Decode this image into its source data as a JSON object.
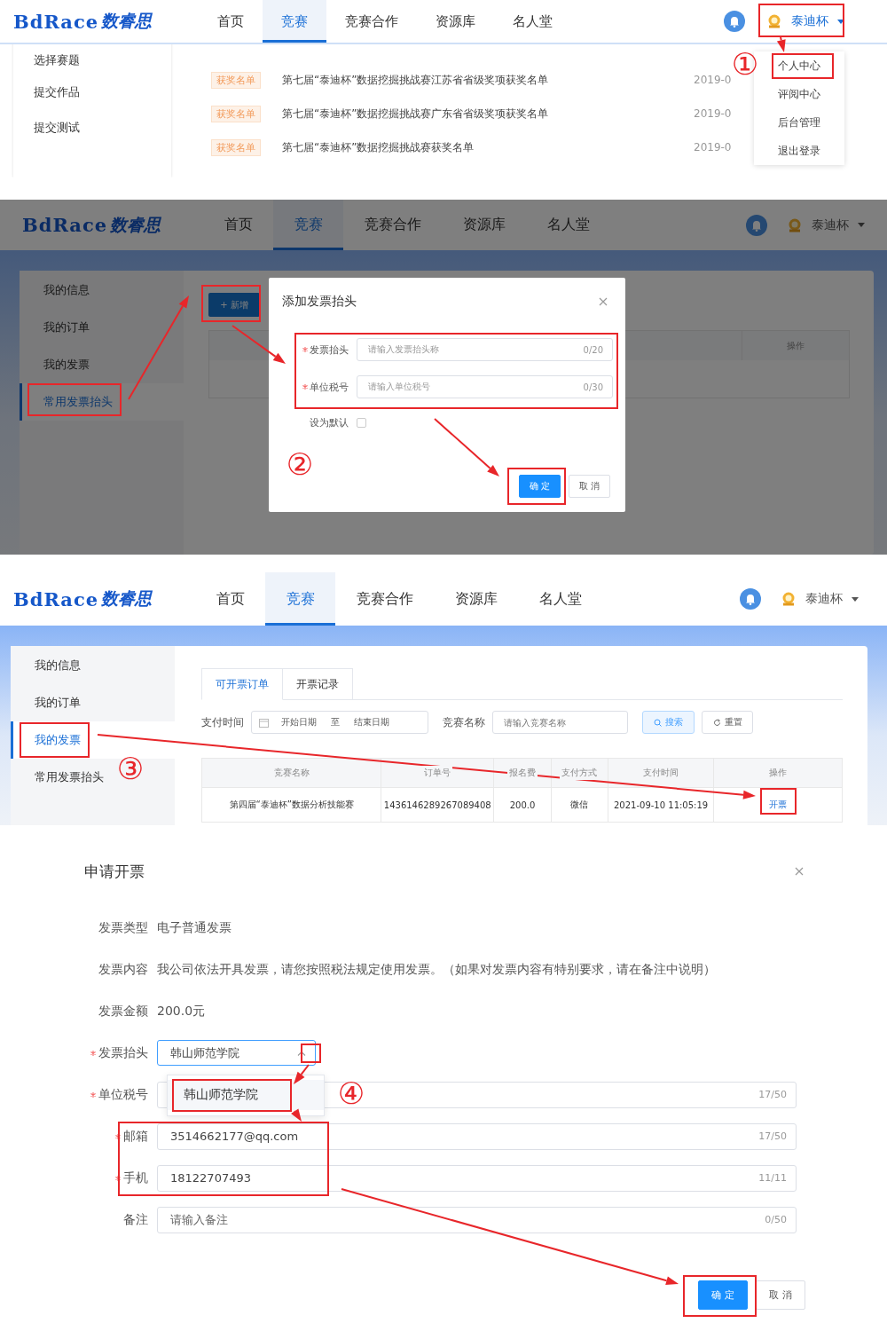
{
  "step1": {
    "header": {
      "logo_latin": "BdRace",
      "logo_cjk": "数睿思",
      "nav": [
        {
          "label": "首页",
          "selected": false
        },
        {
          "label": "竞赛",
          "selected": true
        },
        {
          "label": "竞赛合作",
          "selected": false
        },
        {
          "label": "资源库",
          "selected": false
        },
        {
          "label": "名人堂",
          "selected": false
        }
      ],
      "user": {
        "name": "泰迪杯",
        "active": true
      }
    },
    "sidebar": [
      "选择赛题",
      "提交作品",
      "提交测试"
    ],
    "news": [
      {
        "tag": "获奖名单",
        "title": "第七届“泰迪杯”数据挖掘挑战赛江苏省省级奖项获奖名单",
        "date": "2019-0"
      },
      {
        "tag": "获奖名单",
        "title": "第七届“泰迪杯”数据挖掘挑战赛广东省省级奖项获奖名单",
        "date": "2019-0"
      },
      {
        "tag": "获奖名单",
        "title": "第七届“泰迪杯”数据挖掘挑战赛获奖名单",
        "date": "2019-0"
      }
    ],
    "user_menu": [
      "个人中心",
      "评阅中心",
      "后台管理",
      "退出登录"
    ],
    "marker": "①"
  },
  "step2": {
    "header": {
      "logo_latin": "BdRace",
      "logo_cjk": "数睿思",
      "nav": [
        {
          "label": "首页",
          "selected": false
        },
        {
          "label": "竞赛",
          "selected": true
        },
        {
          "label": "竞赛合作",
          "selected": false
        },
        {
          "label": "资源库",
          "selected": false
        },
        {
          "label": "名人堂",
          "selected": false
        }
      ],
      "user": {
        "name": "泰迪杯",
        "active": false
      }
    },
    "sidebar": [
      {
        "label": "我的信息",
        "selected": false
      },
      {
        "label": "我的订单",
        "selected": false
      },
      {
        "label": "我的发票",
        "selected": false
      },
      {
        "label": "常用发票抬头",
        "selected": true
      }
    ],
    "add_button": "+ 新增",
    "table": {
      "columns": [
        "操作"
      ]
    },
    "dialog": {
      "title": "添加发票抬头",
      "fields": [
        {
          "label": "发票抬头",
          "required": true,
          "placeholder": "请输入发票抬头称",
          "count": "0/20"
        },
        {
          "label": "单位税号",
          "required": true,
          "placeholder": "请输入单位税号",
          "count": "0/30"
        }
      ],
      "default_checkbox": {
        "label": "设为默认",
        "checked": false
      },
      "buttons": [
        {
          "label": "确 定",
          "kind": "primary"
        },
        {
          "label": "取 消",
          "kind": "default"
        }
      ]
    },
    "marker": "②"
  },
  "step3": {
    "header": {
      "logo_latin": "BdRace",
      "logo_cjk": "数睿思",
      "nav": [
        {
          "label": "首页",
          "selected": false
        },
        {
          "label": "竞赛",
          "selected": true
        },
        {
          "label": "竞赛合作",
          "selected": false
        },
        {
          "label": "资源库",
          "selected": false
        },
        {
          "label": "名人堂",
          "selected": false
        }
      ],
      "user": {
        "name": "泰迪杯",
        "active": false
      }
    },
    "sidebar": [
      {
        "label": "我的信息",
        "selected": false
      },
      {
        "label": "我的订单",
        "selected": false
      },
      {
        "label": "我的发票",
        "selected": true
      },
      {
        "label": "常用发票抬头",
        "selected": false
      }
    ],
    "tabs": [
      {
        "label": "可开票订单",
        "selected": true
      },
      {
        "label": "开票记录",
        "selected": false
      }
    ],
    "filters": {
      "time_label": "支付时间",
      "start_placeholder": "开始日期",
      "separator": "至",
      "end_placeholder": "结束日期",
      "name_label": "竞赛名称",
      "name_placeholder": "请输入竞赛名称",
      "search_button": "搜索",
      "reset_button": "重置"
    },
    "table": {
      "columns": [
        "竞赛名称",
        "订单号",
        "报名费",
        "支付方式",
        "支付时间",
        "操作"
      ],
      "rows": [
        {
          "cells": [
            "第四届“泰迪杯”数据分析技能赛",
            "1436146289267089408",
            "200.0",
            "微信",
            "2021-09-10 11:05:19"
          ],
          "action": "开票"
        }
      ]
    },
    "marker": "③"
  },
  "step4": {
    "title": "申请开票",
    "info": [
      {
        "label": "发票类型",
        "value": "电子普通发票"
      },
      {
        "label": "发票内容",
        "value": "我公司依法开具发票，请您按照税法规定使用发票。（如果对发票内容有特别要求，请在备注中说明）"
      },
      {
        "label": "发票金额",
        "value": "200.0元"
      }
    ],
    "fields": [
      {
        "kind": "select",
        "label": "发票抬头",
        "required": true,
        "value": "韩山师范学院",
        "expanded": true
      },
      {
        "kind": "input",
        "label": "单位税号",
        "required": true,
        "count": "17/50"
      },
      {
        "kind": "input",
        "label": "邮箱",
        "required": true,
        "value": "3514662177@qq.com",
        "count": "17/50"
      },
      {
        "kind": "input",
        "label": "手机",
        "required": true,
        "value": "18122707493",
        "count": "11/11"
      },
      {
        "kind": "input",
        "label": "备注",
        "required": false,
        "placeholder": "请输入备注",
        "count": "0/50"
      }
    ],
    "dropdown_options": [
      {
        "label": "韩山师范学院",
        "selected": true
      }
    ],
    "buttons": [
      {
        "label": "确 定",
        "kind": "primary"
      },
      {
        "label": "取 消",
        "kind": "default"
      }
    ],
    "marker": "④"
  }
}
